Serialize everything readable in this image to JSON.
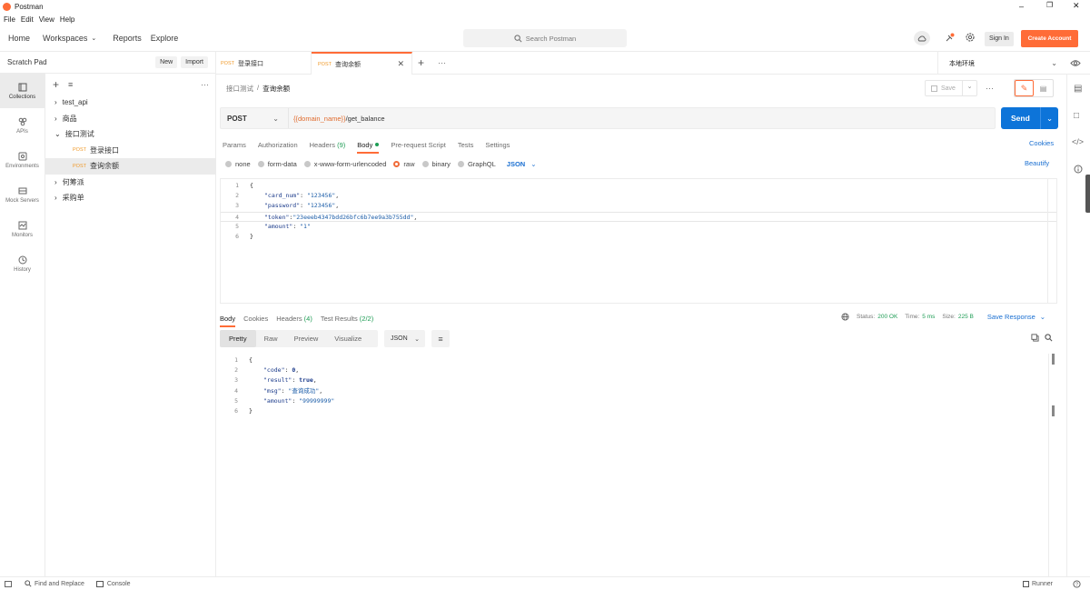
{
  "app": {
    "title": "Postman",
    "menu": [
      "File",
      "Edit",
      "View",
      "Help"
    ]
  },
  "header": {
    "nav": [
      "Home",
      "Workspaces",
      "Reports",
      "Explore"
    ],
    "search_placeholder": "Search Postman",
    "sign_in": "Sign In",
    "create_account": "Create Account"
  },
  "sidebar": {
    "scratch_title": "Scratch Pad",
    "new_label": "New",
    "import_label": "Import",
    "rail": [
      {
        "label": "Collections",
        "icon": "collections-icon"
      },
      {
        "label": "APIs",
        "icon": "apis-icon"
      },
      {
        "label": "Environments",
        "icon": "environments-icon"
      },
      {
        "label": "Mock Servers",
        "icon": "mock-servers-icon"
      },
      {
        "label": "Monitors",
        "icon": "monitors-icon"
      },
      {
        "label": "History",
        "icon": "history-icon"
      }
    ],
    "tree": {
      "test_api": "test_api",
      "goods": "商品",
      "iface_test": "接口测试",
      "post1_method": "POST",
      "post1_name": "登录接口",
      "post2_method": "POST",
      "post2_name": "查询余额",
      "hetaopai": "何筹派",
      "purchase": "采购单"
    }
  },
  "tabs": [
    {
      "method": "POST",
      "name": "登录接口"
    },
    {
      "method": "POST",
      "name": "查询余额"
    }
  ],
  "environment": "本地环境",
  "request": {
    "breadcrumb_parent": "接口测试",
    "breadcrumb_sep": "/",
    "breadcrumb_current": "查询余额",
    "save_label": "Save",
    "method": "POST",
    "url_var": "{{domain_name}}",
    "url_path": "/get_balance",
    "send_label": "Send",
    "tabs": {
      "params": "Params",
      "authorization": "Authorization",
      "headers": "Headers",
      "headers_count": "(9)",
      "body": "Body",
      "prerequest": "Pre-request Script",
      "tests": "Tests",
      "settings": "Settings",
      "cookies": "Cookies"
    },
    "body_types": {
      "none": "none",
      "form_data": "form-data",
      "urlencoded": "x-www-form-urlencoded",
      "raw": "raw",
      "binary": "binary",
      "graphql": "GraphQL",
      "json": "JSON",
      "beautify": "Beautify"
    },
    "body_lines": [
      {
        "n": "1",
        "text": "{"
      },
      {
        "n": "2",
        "key": "\"card_num\"",
        "sep": ": ",
        "val": "\"123456\"",
        "end": ","
      },
      {
        "n": "3",
        "key": "\"password\"",
        "sep": ": ",
        "val": "\"123456\"",
        "end": ","
      },
      {
        "n": "4",
        "key": "\"token\"",
        "sep": ":",
        "val": "\"23eeeb4347bdd26bfc6b7ee9a3b755dd\"",
        "end": ","
      },
      {
        "n": "5",
        "key": "\"amount\"",
        "sep": ": ",
        "val": "\"1\"",
        "end": ""
      },
      {
        "n": "6",
        "text": "}"
      }
    ]
  },
  "response": {
    "tabs": {
      "body": "Body",
      "cookies": "Cookies",
      "headers": "Headers",
      "headers_count": "(4)",
      "test_results": "Test Results",
      "test_count": "(2/2)"
    },
    "status_label": "Status:",
    "status_value": "200 OK",
    "time_label": "Time:",
    "time_value": "5 ms",
    "size_label": "Size:",
    "size_value": "225 B",
    "save_response": "Save Response",
    "views": {
      "pretty": "Pretty",
      "raw": "Raw",
      "preview": "Preview",
      "visualize": "Visualize",
      "json": "JSON"
    },
    "body_lines": [
      {
        "n": "1",
        "text": "{"
      },
      {
        "n": "2",
        "key": "\"code\"",
        "sep": ": ",
        "val": "0",
        "end": ","
      },
      {
        "n": "3",
        "key": "\"result\"",
        "sep": ": ",
        "val": "true",
        "end": ","
      },
      {
        "n": "4",
        "key": "\"msg\"",
        "sep": ": ",
        "val": "\"查询成功\"",
        "end": ","
      },
      {
        "n": "5",
        "key": "\"amount\"",
        "sep": ": ",
        "val": "\"99999999\"",
        "end": ""
      },
      {
        "n": "6",
        "text": "}"
      }
    ]
  },
  "footer": {
    "find_replace": "Find and Replace",
    "console": "Console",
    "runner": "Runner"
  },
  "colors": {
    "accent": "#ff6c37",
    "send": "#0d74d9",
    "link": "#1a6fd1",
    "status_ok": "#1f9d55"
  }
}
